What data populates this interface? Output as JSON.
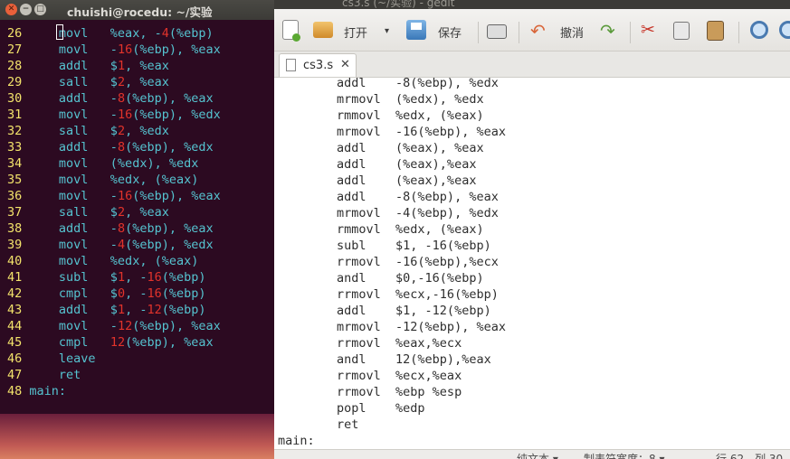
{
  "terminal": {
    "title": "chuishi@rocedu: ~/实验",
    "lines": [
      {
        "n": "26",
        "parts": [
          {
            "t": "movl",
            "c": "op"
          },
          {
            "t": "   %eax, -",
            "c": "op"
          },
          {
            "t": "4",
            "c": "num"
          },
          {
            "t": "(%ebp)",
            "c": "op"
          }
        ]
      },
      {
        "n": "27",
        "parts": [
          {
            "t": "movl",
            "c": "op"
          },
          {
            "t": "   -",
            "c": "op"
          },
          {
            "t": "16",
            "c": "num"
          },
          {
            "t": "(%ebp), %eax",
            "c": "op"
          }
        ]
      },
      {
        "n": "28",
        "parts": [
          {
            "t": "addl",
            "c": "op"
          },
          {
            "t": "   $",
            "c": "op"
          },
          {
            "t": "1",
            "c": "num"
          },
          {
            "t": ", %eax",
            "c": "op"
          }
        ]
      },
      {
        "n": "29",
        "parts": [
          {
            "t": "sall",
            "c": "op"
          },
          {
            "t": "   $",
            "c": "op"
          },
          {
            "t": "2",
            "c": "num"
          },
          {
            "t": ", %eax",
            "c": "op"
          }
        ]
      },
      {
        "n": "30",
        "parts": [
          {
            "t": "addl",
            "c": "op"
          },
          {
            "t": "   -",
            "c": "op"
          },
          {
            "t": "8",
            "c": "num"
          },
          {
            "t": "(%ebp), %eax",
            "c": "op"
          }
        ]
      },
      {
        "n": "31",
        "parts": [
          {
            "t": "movl",
            "c": "op"
          },
          {
            "t": "   -",
            "c": "op"
          },
          {
            "t": "16",
            "c": "num"
          },
          {
            "t": "(%ebp), %edx",
            "c": "op"
          }
        ]
      },
      {
        "n": "32",
        "parts": [
          {
            "t": "sall",
            "c": "op"
          },
          {
            "t": "   $",
            "c": "op"
          },
          {
            "t": "2",
            "c": "num"
          },
          {
            "t": ", %edx",
            "c": "op"
          }
        ]
      },
      {
        "n": "33",
        "parts": [
          {
            "t": "addl",
            "c": "op"
          },
          {
            "t": "   -",
            "c": "op"
          },
          {
            "t": "8",
            "c": "num"
          },
          {
            "t": "(%ebp), %edx",
            "c": "op"
          }
        ]
      },
      {
        "n": "34",
        "parts": [
          {
            "t": "movl",
            "c": "op"
          },
          {
            "t": "   (%edx), %edx",
            "c": "op"
          }
        ]
      },
      {
        "n": "35",
        "parts": [
          {
            "t": "movl",
            "c": "op"
          },
          {
            "t": "   %edx, (%eax)",
            "c": "op"
          }
        ]
      },
      {
        "n": "36",
        "parts": [
          {
            "t": "movl",
            "c": "op"
          },
          {
            "t": "   -",
            "c": "op"
          },
          {
            "t": "16",
            "c": "num"
          },
          {
            "t": "(%ebp), %eax",
            "c": "op"
          }
        ]
      },
      {
        "n": "37",
        "parts": [
          {
            "t": "sall",
            "c": "op"
          },
          {
            "t": "   $",
            "c": "op"
          },
          {
            "t": "2",
            "c": "num"
          },
          {
            "t": ", %eax",
            "c": "op"
          }
        ]
      },
      {
        "n": "38",
        "parts": [
          {
            "t": "addl",
            "c": "op"
          },
          {
            "t": "   -",
            "c": "op"
          },
          {
            "t": "8",
            "c": "num"
          },
          {
            "t": "(%ebp), %eax",
            "c": "op"
          }
        ]
      },
      {
        "n": "39",
        "parts": [
          {
            "t": "movl",
            "c": "op"
          },
          {
            "t": "   -",
            "c": "op"
          },
          {
            "t": "4",
            "c": "num"
          },
          {
            "t": "(%ebp), %edx",
            "c": "op"
          }
        ]
      },
      {
        "n": "40",
        "parts": [
          {
            "t": "movl",
            "c": "op"
          },
          {
            "t": "   %edx, (%eax)",
            "c": "op"
          }
        ]
      },
      {
        "n": "41",
        "parts": [
          {
            "t": "subl",
            "c": "op"
          },
          {
            "t": "   $",
            "c": "op"
          },
          {
            "t": "1",
            "c": "num"
          },
          {
            "t": ", -",
            "c": "op"
          },
          {
            "t": "16",
            "c": "num"
          },
          {
            "t": "(%ebp)",
            "c": "op"
          }
        ]
      },
      {
        "n": "42",
        "parts": [
          {
            "t": "cmpl",
            "c": "op"
          },
          {
            "t": "   $",
            "c": "op"
          },
          {
            "t": "0",
            "c": "num"
          },
          {
            "t": ", -",
            "c": "op"
          },
          {
            "t": "16",
            "c": "num"
          },
          {
            "t": "(%ebp)",
            "c": "op"
          }
        ]
      },
      {
        "n": "43",
        "parts": [
          {
            "t": "addl",
            "c": "op"
          },
          {
            "t": "   $",
            "c": "op"
          },
          {
            "t": "1",
            "c": "num"
          },
          {
            "t": ", -",
            "c": "op"
          },
          {
            "t": "12",
            "c": "num"
          },
          {
            "t": "(%ebp)",
            "c": "op"
          }
        ]
      },
      {
        "n": "44",
        "parts": [
          {
            "t": "movl",
            "c": "op"
          },
          {
            "t": "   -",
            "c": "op"
          },
          {
            "t": "12",
            "c": "num"
          },
          {
            "t": "(%ebp), %eax",
            "c": "op"
          }
        ]
      },
      {
        "n": "45",
        "parts": [
          {
            "t": "cmpl",
            "c": "op"
          },
          {
            "t": "   ",
            "c": "op"
          },
          {
            "t": "12",
            "c": "num"
          },
          {
            "t": "(%ebp), %eax",
            "c": "op"
          }
        ]
      },
      {
        "n": "46",
        "parts": [
          {
            "t": "leave",
            "c": "op"
          }
        ]
      },
      {
        "n": "47",
        "parts": [
          {
            "t": "ret",
            "c": "op"
          }
        ]
      },
      {
        "n": "48",
        "label": "main:"
      }
    ]
  },
  "gedit": {
    "title": "cs3.s (~/实验) - gedit",
    "toolbar": {
      "open_label": "打开",
      "save_label": "保存",
      "undo_label": "撤消"
    },
    "tab": {
      "label": "cs3.s"
    },
    "code": [
      "        addl    -8(%ebp), %edx",
      "        mrmovl  (%edx), %edx",
      "        rmmovl  %edx, (%eax)",
      "        mrmovl  -16(%ebp), %eax",
      "        addl    (%eax), %eax",
      "        addl    (%eax),%eax",
      "        addl    (%eax),%eax",
      "        addl    -8(%ebp), %eax",
      "        mrmovl  -4(%ebp), %edx",
      "        rmmovl  %edx, (%eax)",
      "        subl    $1, -16(%ebp)",
      "        rrmovl  -16(%ebp),%ecx",
      "        andl    $0,-16(%ebp)",
      "        rrmovl  %ecx,-16(%ebp)",
      "        addl    $1, -12(%ebp)",
      "        mrmovl  -12(%ebp), %eax",
      "        rrmovl  %eax,%ecx",
      "        andl    12(%ebp),%eax",
      "        rrmovl  %ecx,%eax",
      "        rrmovl  %ebp %esp",
      "        popl    %edp",
      "        ret",
      "main:"
    ],
    "status": {
      "language": "纯文本 ▾",
      "tab_width": "制表符宽度：8 ▾",
      "position": "行 62，列 30"
    }
  },
  "colors": {
    "terminal_bg": "#2c0a21",
    "terminal_text": "#55c3d0",
    "terminal_number": "#e2332b",
    "terminal_line_no": "#f3e36b"
  }
}
